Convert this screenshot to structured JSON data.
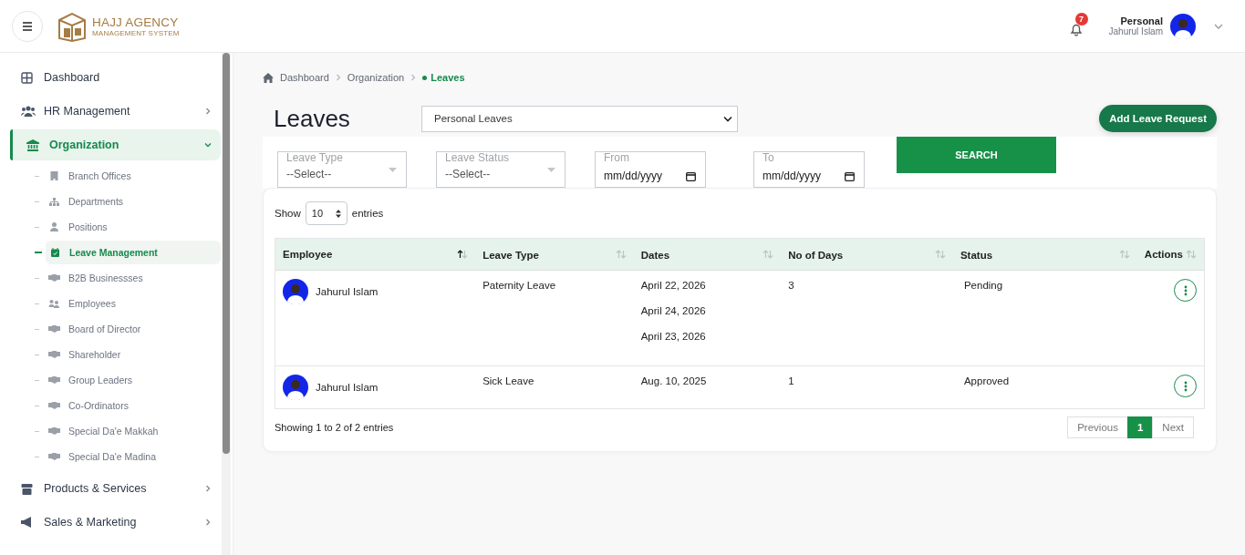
{
  "header": {
    "brand_title": "HAJJ AGENCY",
    "brand_subtitle": "MANAGEMENT SYSTEM",
    "notification_count": "7",
    "user_role": "Personal",
    "user_name": "Jahurul Islam"
  },
  "sidebar": {
    "items": [
      {
        "label": "Dashboard",
        "selected": false
      },
      {
        "label": "HR Management",
        "selected": false,
        "expanded": false
      },
      {
        "label": "Organization",
        "selected": true,
        "expanded": true,
        "children": [
          {
            "label": "Branch Offices",
            "selected": false
          },
          {
            "label": "Departments",
            "selected": false
          },
          {
            "label": "Positions",
            "selected": false
          },
          {
            "label": "Leave Management",
            "selected": true
          },
          {
            "label": "B2B Businessses",
            "selected": false
          },
          {
            "label": "Employees",
            "selected": false
          },
          {
            "label": "Board of Director",
            "selected": false
          },
          {
            "label": "Shareholder",
            "selected": false
          },
          {
            "label": "Group Leaders",
            "selected": false
          },
          {
            "label": "Co-Ordinators",
            "selected": false
          },
          {
            "label": "Special Da'e Makkah",
            "selected": false
          },
          {
            "label": "Special Da'e Madina",
            "selected": false
          }
        ]
      },
      {
        "label": "Products & Services",
        "selected": false,
        "expanded": false
      },
      {
        "label": "Sales & Marketing",
        "selected": false,
        "expanded": false
      }
    ]
  },
  "breadcrumb": [
    {
      "label": "Dashboard",
      "selected": false
    },
    {
      "label": "Organization",
      "selected": false
    },
    {
      "label": "Leaves",
      "selected": true
    }
  ],
  "page_title": "Leaves",
  "leave_scope": {
    "value": "Personal Leaves"
  },
  "add_button": "Add Leave Request",
  "filters": [
    {
      "kind": "select",
      "label": "Leave Type",
      "value": "--Select--"
    },
    {
      "kind": "select",
      "label": "Leave Status",
      "value": "--Select--"
    },
    {
      "kind": "date",
      "label": "From",
      "placeholder": "mm/dd/yyyy"
    },
    {
      "kind": "date",
      "label": "To",
      "placeholder": "mm/dd/yyyy"
    }
  ],
  "search_button": "SEARCH",
  "table": {
    "show_label": "Show",
    "page_size": "10",
    "entries_label": "entries",
    "columns": [
      {
        "label": "Employee",
        "sorted": true
      },
      {
        "label": "Leave Type",
        "sorted": false
      },
      {
        "label": "Dates",
        "sorted": false
      },
      {
        "label": "No of Days",
        "sorted": false
      },
      {
        "label": "Status",
        "sorted": false
      },
      {
        "label": "Actions",
        "sorted": false
      }
    ],
    "rows": [
      {
        "employee": "Jahurul Islam",
        "leave_type": "Paternity Leave",
        "dates": [
          "April 22, 2026",
          "April 24, 2026",
          "April 23, 2026"
        ],
        "days": "3",
        "status": "Pending"
      },
      {
        "employee": "Jahurul Islam",
        "leave_type": "Sick Leave",
        "dates": [
          "Aug. 10, 2025"
        ],
        "days": "1",
        "status": "Approved"
      }
    ],
    "info": "Showing 1 to 2 of 2 entries",
    "pagination": [
      {
        "label": "Previous",
        "selected": false
      },
      {
        "label": "1",
        "selected": true
      },
      {
        "label": "Next",
        "selected": false
      }
    ]
  }
}
